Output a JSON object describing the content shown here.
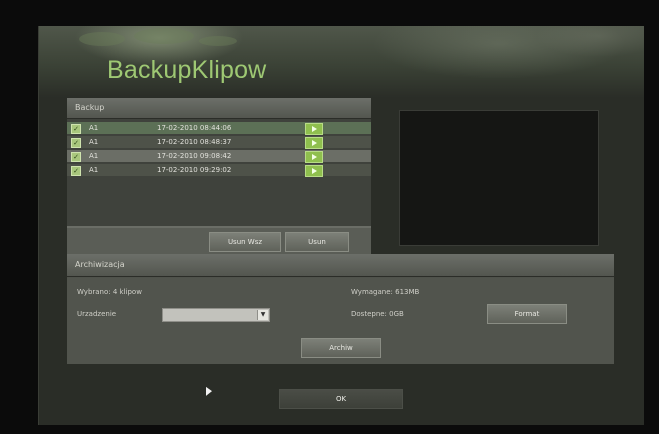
{
  "title": "BackupKlipow",
  "backup": {
    "header": "Backup",
    "rows": [
      {
        "checked": "✓",
        "channel": "A1",
        "timestamp": "17-02-2010 08:44:06"
      },
      {
        "checked": "✓",
        "channel": "A1",
        "timestamp": "17-02-2010 08:48:37"
      },
      {
        "checked": "✓",
        "channel": "A1",
        "timestamp": "17-02-2010 09:08:42"
      },
      {
        "checked": "✓",
        "channel": "A1",
        "timestamp": "17-02-2010 09:29:02"
      }
    ],
    "delete_all_label": "Usun Wsz",
    "delete_label": "Usun"
  },
  "archive": {
    "header": "Archiwizacja",
    "selected_text": "Wybrano: 4 klipow",
    "required_text": "Wymagane: 613MB",
    "device_label": "Urzadzenie",
    "device_value": "",
    "available_text": "Dostepne: 0GB",
    "format_label": "Format",
    "archive_label": "Archiw"
  },
  "ok_label": "OK",
  "colors": {
    "title_green": "#9ec873",
    "play_green": "#8fbf4e",
    "panel_bg": "#3f423c"
  }
}
